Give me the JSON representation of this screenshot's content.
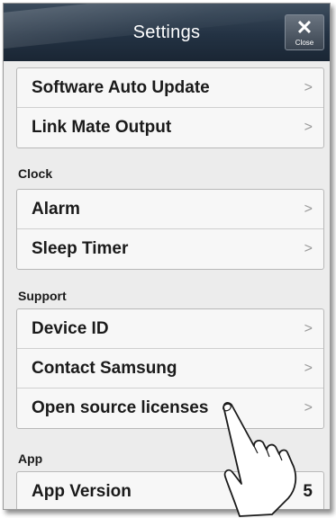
{
  "header": {
    "title": "Settings",
    "close_glyph": "✕",
    "close_label": "Close"
  },
  "sections": [
    {
      "label": "",
      "items": [
        {
          "label": "Software Auto Update",
          "chevron": ">"
        },
        {
          "label": "Link Mate Output",
          "chevron": ">"
        }
      ]
    },
    {
      "label": "Clock",
      "items": [
        {
          "label": "Alarm",
          "chevron": ">"
        },
        {
          "label": "Sleep Timer",
          "chevron": ">"
        }
      ]
    },
    {
      "label": "Support",
      "items": [
        {
          "label": "Device ID",
          "chevron": ">"
        },
        {
          "label": "Contact Samsung",
          "chevron": ">"
        },
        {
          "label": "Open source licenses",
          "chevron": ">"
        }
      ]
    },
    {
      "label": "App",
      "items": [
        {
          "label": "App Version",
          "value": "5"
        }
      ]
    }
  ],
  "icons": {
    "close": "close-icon",
    "chevron": "chevron-right-icon",
    "pointer": "hand-pointer-icon"
  }
}
